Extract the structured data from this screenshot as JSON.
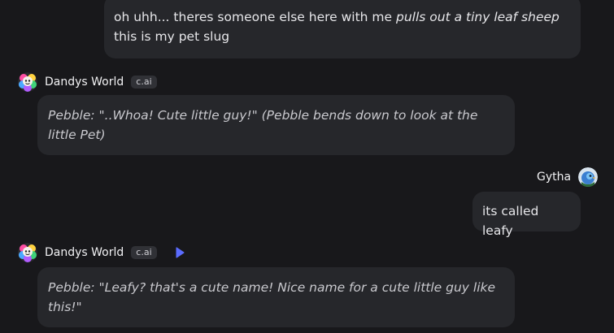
{
  "messages": [
    {
      "role": "user",
      "text_plain": "oh uhh... theres someone else here with me ",
      "text_italic": "pulls out a tiny leaf sheep",
      "text_line2": "this is my pet slug"
    },
    {
      "role": "character",
      "name": "Dandys World",
      "badge": "c.ai",
      "text": "Pebble: \"..Whoa! Cute little guy!\" (Pebble bends down to look at the little Pet)"
    },
    {
      "role": "user",
      "name": "Gytha",
      "text": "its called leafy"
    },
    {
      "role": "character",
      "name": "Dandys World",
      "badge": "c.ai",
      "text": "Pebble: \"Leafy? that's a cute name! Nice name for a cute little guy like this!\""
    }
  ],
  "icons": {
    "character_avatar": "rainbow-flower-avatar-icon",
    "user_avatar": "blue-bird-avatar-icon",
    "play": "play-icon"
  },
  "colors": {
    "background": "#18181b",
    "bubble": "#26272b",
    "play_accent": "#5b6cff"
  }
}
